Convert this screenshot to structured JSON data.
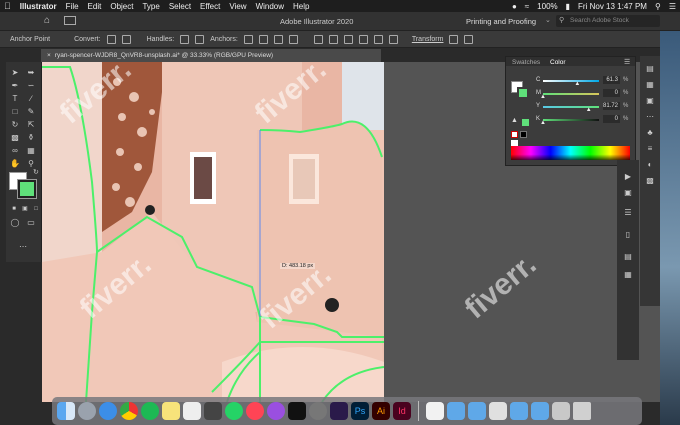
{
  "menubar": {
    "apple": "",
    "app": "Illustrator",
    "items": [
      "File",
      "Edit",
      "Object",
      "Type",
      "Select",
      "Effect",
      "View",
      "Window",
      "Help"
    ],
    "battery": "100%",
    "datetime": "Fri Nov 13  1:47 PM"
  },
  "appbar": {
    "title": "Adobe Illustrator 2020",
    "workspace": "Printing and Proofing",
    "search_placeholder": "Search Adobe Stock"
  },
  "control": {
    "anchor_point": "Anchor Point",
    "convert": "Convert:",
    "handles": "Handles:",
    "anchors": "Anchors:",
    "transform": "Transform"
  },
  "document": {
    "tab": "ryan-spencer-WJDR8_QnVR8-unsplash.ai* @ 33.33% (RGB/GPU Preview)",
    "tooltip": "D: 483.18 px"
  },
  "color_panel": {
    "tab_swatches": "Swatches",
    "tab_color": "Color",
    "channels": [
      {
        "label": "C",
        "value": "61.3",
        "unit": "%",
        "level": 0.613
      },
      {
        "label": "M",
        "value": "0",
        "unit": "%",
        "level": 0.0
      },
      {
        "label": "Y",
        "value": "81.72",
        "unit": "%",
        "level": 0.817
      },
      {
        "label": "K",
        "value": "0",
        "unit": "%",
        "level": 0.0
      }
    ],
    "fill_color": "#5fe07a"
  },
  "watermark": "fiverr.",
  "dock": {
    "labels": {
      "ps": "Ps",
      "ai": "Ai",
      "id": "Id"
    }
  },
  "colors": {
    "path_green": "#4cf06a",
    "artboard_pink": "#e9b6a4",
    "wall_pink": "#eebfb0"
  }
}
